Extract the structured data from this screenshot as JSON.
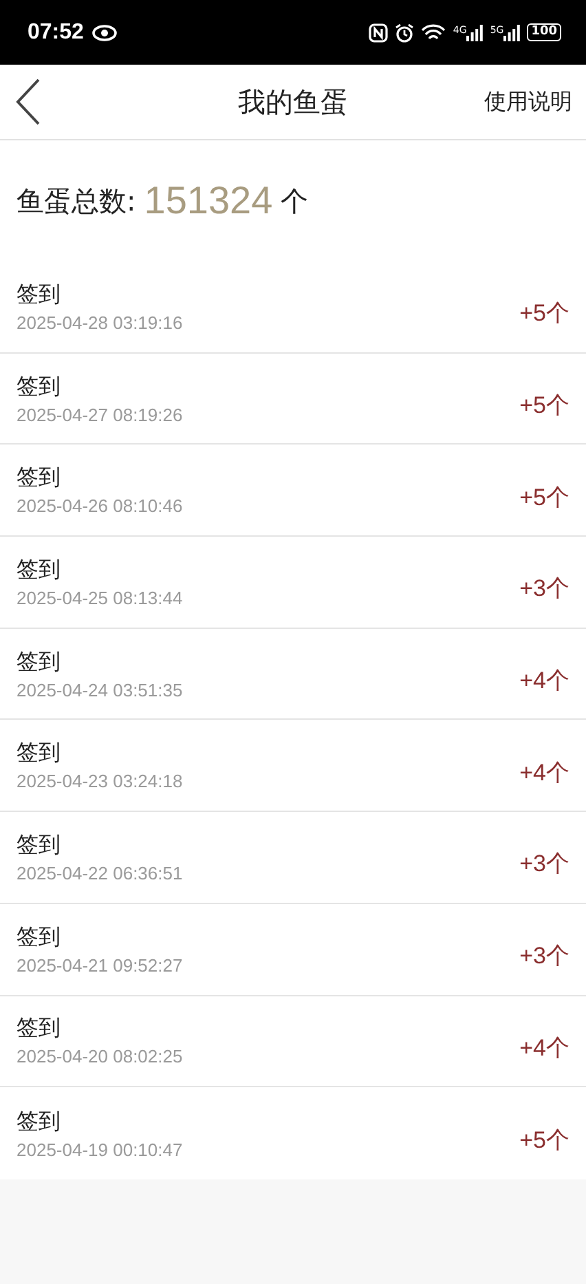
{
  "status_bar": {
    "time": "07:52",
    "networks": [
      "4G",
      "5G"
    ],
    "battery": "100"
  },
  "header": {
    "title": "我的鱼蛋",
    "action": "使用说明"
  },
  "summary": {
    "label": "鱼蛋总数:",
    "count": "151324",
    "unit": "个"
  },
  "records": [
    {
      "title": "签到",
      "time": "2025-04-28 03:19:16",
      "amount": "+5个"
    },
    {
      "title": "签到",
      "time": "2025-04-27 08:19:26",
      "amount": "+5个"
    },
    {
      "title": "签到",
      "time": "2025-04-26 08:10:46",
      "amount": "+5个"
    },
    {
      "title": "签到",
      "time": "2025-04-25 08:13:44",
      "amount": "+3个"
    },
    {
      "title": "签到",
      "time": "2025-04-24 03:51:35",
      "amount": "+4个"
    },
    {
      "title": "签到",
      "time": "2025-04-23 03:24:18",
      "amount": "+4个"
    },
    {
      "title": "签到",
      "time": "2025-04-22 06:36:51",
      "amount": "+3个"
    },
    {
      "title": "签到",
      "time": "2025-04-21 09:52:27",
      "amount": "+3个"
    },
    {
      "title": "签到",
      "time": "2025-04-20 08:02:25",
      "amount": "+4个"
    },
    {
      "title": "签到",
      "time": "2025-04-19 00:10:47",
      "amount": "+5个"
    }
  ]
}
